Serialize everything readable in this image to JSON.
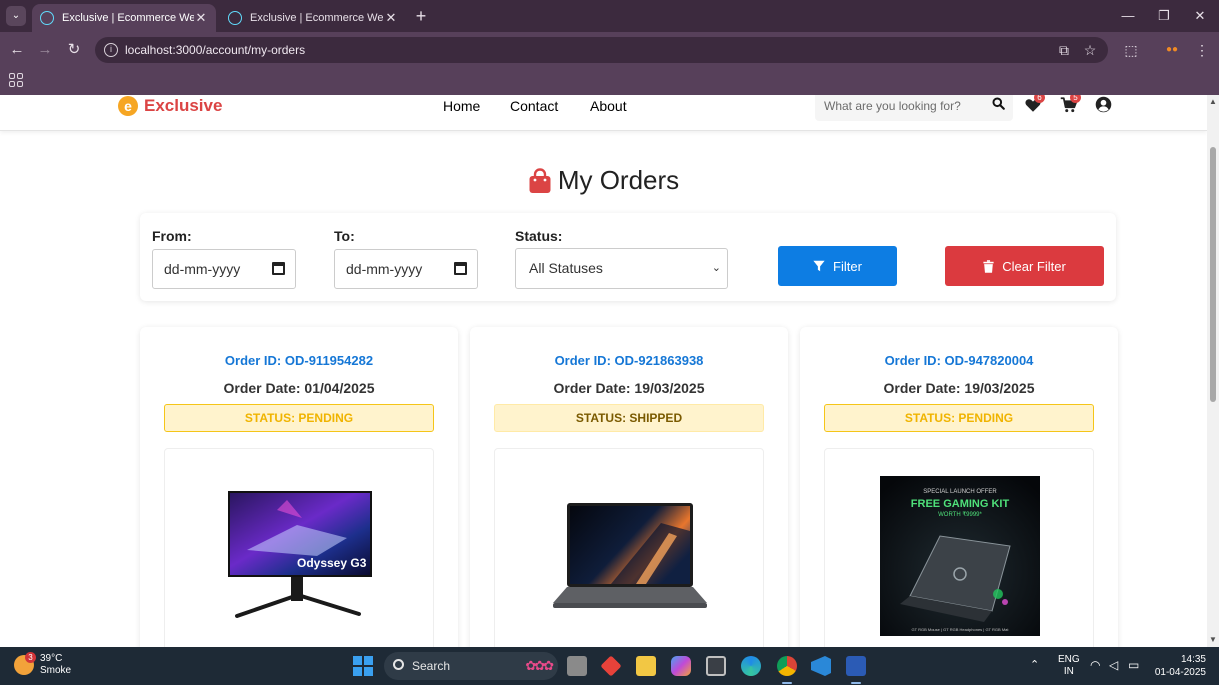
{
  "browser": {
    "tabs": [
      {
        "label": "Exclusive | Ecommerce Website",
        "active": true
      },
      {
        "label": "Exclusive | Ecommerce Website",
        "active": false
      }
    ],
    "url": "localhost:3000/account/my-orders"
  },
  "site": {
    "logo_letter": "e",
    "brand": "Exclusive",
    "nav": [
      "Home",
      "Contact",
      "About"
    ],
    "search_placeholder": "What are you looking for?",
    "wishlist_count": "6",
    "cart_count": "5"
  },
  "page": {
    "title": "My Orders"
  },
  "filters": {
    "from_label": "From:",
    "from_value": "dd-mm-yyyy",
    "to_label": "To:",
    "to_value": "dd-mm-yyyy",
    "status_label": "Status:",
    "status_value": "All Statuses",
    "filter_button": "Filter",
    "clear_button": "Clear Filter"
  },
  "orders": [
    {
      "id": "Order ID: OD-911954282",
      "date": "Order Date: 01/04/2025",
      "status": "STATUS: PENDING",
      "status_key": "pending",
      "image": "odyssey-g3-monitor",
      "image_text": "Odyssey G3"
    },
    {
      "id": "Order ID: OD-921863938",
      "date": "Order Date: 19/03/2025",
      "status": "STATUS: SHIPPED",
      "status_key": "shipped",
      "image": "laptop"
    },
    {
      "id": "Order ID: OD-947820004",
      "date": "Order Date: 19/03/2025",
      "status": "STATUS: PENDING",
      "status_key": "pending",
      "image": "gaming-laptop-offer",
      "image_text": {
        "offer": "SPECIAL LAUNCH OFFER",
        "headline": "FREE GAMING KIT",
        "sub": "WORTH ₹9999*",
        "footer": "GT RGB Mouse | GT RGB Headphones | GT RGB Mat"
      }
    }
  ],
  "taskbar": {
    "weather_temp": "39°C",
    "weather_desc": "Smoke",
    "weather_badge": "3",
    "search_label": "Search",
    "lang_line1": "ENG",
    "lang_line2": "IN",
    "time": "14:35",
    "date": "01-04-2025"
  },
  "colors": {
    "brand_red": "#db4444",
    "link_blue": "#1577d6",
    "filter_blue": "#0d7de3",
    "pending_text": "#f0b400",
    "status_bg": "#fff3cd"
  }
}
